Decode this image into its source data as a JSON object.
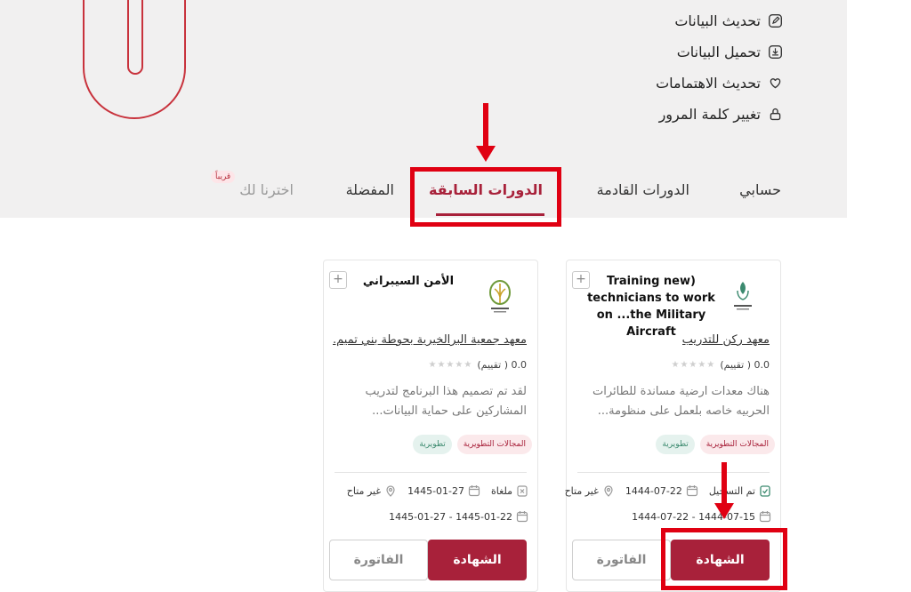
{
  "profile_menu": {
    "update_data": "تحديث البيانات",
    "download_data": "تحميل البيانات",
    "update_interests": "تحديث الاهتمامات",
    "change_password": "تغيير كلمة المرور"
  },
  "tabs": {
    "my_account": "حسابي",
    "upcoming": "الدورات القادمة",
    "previous": "الدورات السابقة",
    "favorites": "المفضلة",
    "picked_for_you": "اخترنا لك",
    "soon_badge": "قريباً"
  },
  "cards": [
    {
      "title": "Training new) technicians to work on ...the Military Aircraft",
      "provider": "معهد ركن للتدريب",
      "rating": "0.0 ( تقييم)",
      "description": "هناك معدات ارضية مساندة للطائرات الحربيه خاصه بلعمل على منظومة...",
      "tag_field": "المجالات التطويرية",
      "tag_type": "تطويرية",
      "status": "تم التسجيل",
      "date": "1444-07-22",
      "availability": "غير متاح",
      "date_range": "1444-07-15 - 1444-07-22",
      "certificate_button": "الشهادة",
      "invoice_button": "الفاتورة"
    },
    {
      "title": "الأمن السيبراني",
      "provider": "معهد جمعية البرالخيرية بحوطة بني تميم...",
      "rating": "0.0 ( تقييم)",
      "description": "لقد تم تصميم هذا البرنامج لتدريب المشاركين على حماية البيانات...",
      "tag_field": "المجالات التطويرية",
      "tag_type": "تطويرية",
      "status": "ملغاة",
      "date": "1445-01-27",
      "availability": "غير متاح",
      "date_range": "1445-01-22 - 1445-01-27",
      "certificate_button": "الشهادة",
      "invoice_button": "الفاتورة"
    }
  ],
  "colors": {
    "brand": "#a8213a",
    "highlight": "#e00012",
    "header_bg": "#f1f0f0"
  }
}
